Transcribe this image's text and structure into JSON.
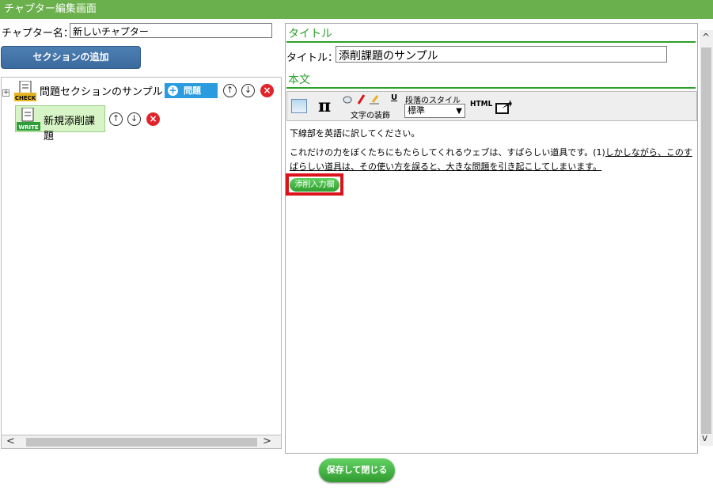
{
  "window": {
    "title": "チャプター編集画面"
  },
  "chapter": {
    "label": "チャプター名：",
    "name_value": "新しいチャプター"
  },
  "buttons": {
    "add_section": "セクションの追加",
    "save_close": "保存して閉じる"
  },
  "tree": {
    "expand_glyph": "+",
    "section": {
      "icon": "check-icon",
      "icon_text": "CHECK",
      "name": "問題セクションのサンプル",
      "add_question_label": "問題",
      "up_glyph": "↑",
      "down_glyph": "↓",
      "delete_glyph": "×"
    },
    "task": {
      "icon": "write-icon",
      "icon_text": "WRITE",
      "name": "新規添削課題",
      "up_glyph": "↑",
      "down_glyph": "↓",
      "delete_glyph": "×"
    }
  },
  "scroll": {
    "left": "<",
    "right": ">",
    "up": "^",
    "down": "v"
  },
  "right_panel": {
    "title_heading": "タイトル",
    "title_label": "タイトル：",
    "title_value": "添削課題のサンプル",
    "body_heading": "本文"
  },
  "editor": {
    "toolbar": {
      "pi": "π",
      "decoration_label": "文字の装飾",
      "underline_glyph": "U",
      "paragraph_label": "段落のスタイル",
      "paragraph_value": "標準",
      "html_label": "HTML"
    },
    "content": {
      "line1": "下線部を英語に訳してください。",
      "line2_plain": "これだけの力をぼくたちにもたらしてくれるウェブは、すばらしい道具です。(1)",
      "line2_underlined": "しかしながら、このすばらしい道具は、その使い方を誤ると、大きな問題を引き起こしてしまいます。",
      "tensaku_button": "添削入力欄"
    }
  },
  "colors": {
    "titlebar": "#6ab04c",
    "accent_green": "#2ca02c",
    "add_section_blue": "#3a6a9e",
    "question_blue": "#2b9be0",
    "delete_red": "#e0242c",
    "highlight_red": "#d9141c",
    "task_bg": "#d7f4c6"
  }
}
